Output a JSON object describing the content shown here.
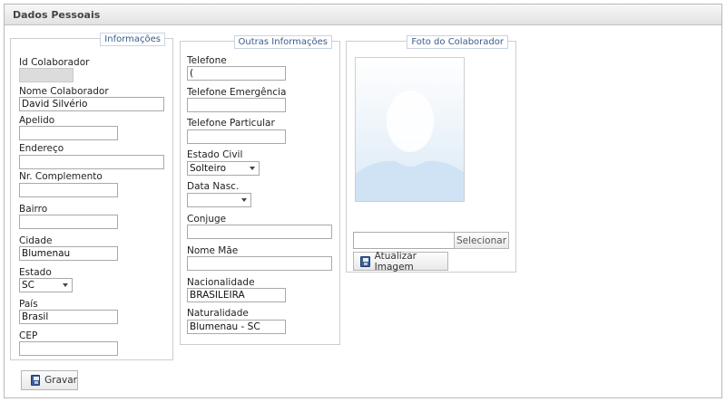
{
  "panel": {
    "title": "Dados Pessoais"
  },
  "info": {
    "legend": "Informações",
    "id_label": "Id Colaborador",
    "id_value": "",
    "nome_label": "Nome Colaborador",
    "nome_value": "David Silvério",
    "apelido_label": "Apelido",
    "apelido_value": "",
    "endereco_label": "Endereço",
    "endereco_value": "",
    "complemento_label": "Nr. Complemento",
    "complemento_value": "",
    "bairro_label": "Bairro",
    "bairro_value": "",
    "cidade_label": "Cidade",
    "cidade_value": "Blumenau",
    "estado_label": "Estado",
    "estado_value": "SC",
    "pais_label": "País",
    "pais_value": "Brasil",
    "cep_label": "CEP",
    "cep_value": ""
  },
  "outras": {
    "legend": "Outras Informações",
    "telefone_label": "Telefone",
    "telefone_value": "(",
    "tel_emergencia_label": "Telefone Emergência",
    "tel_emergencia_value": "",
    "tel_particular_label": "Telefone Particular",
    "tel_particular_value": "",
    "estado_civil_label": "Estado Civil",
    "estado_civil_value": "Solteiro",
    "data_nasc_label": "Data Nasc.",
    "data_nasc_value": "",
    "conjuge_label": "Conjuge",
    "conjuge_value": "",
    "nome_mae_label": "Nome Mãe",
    "nome_mae_value": "",
    "nacionalidade_label": "Nacionalidade",
    "nacionalidade_value": "BRASILEIRA",
    "naturalidade_label": "Naturalidade",
    "naturalidade_value": "Blumenau - SC"
  },
  "foto": {
    "legend": "Foto do Colaborador",
    "file_value": "",
    "select_label": "Selecionar",
    "update_label": "Atualizar Imagem"
  },
  "actions": {
    "save_label": "Gravar"
  },
  "icons": {
    "save": "save-icon",
    "select_arrow": "chevron-down-icon"
  },
  "colors": {
    "legend_text": "#3b5c8a",
    "readonly_bg": "#dcdcdc",
    "header_bg": "#e2e2e2"
  }
}
